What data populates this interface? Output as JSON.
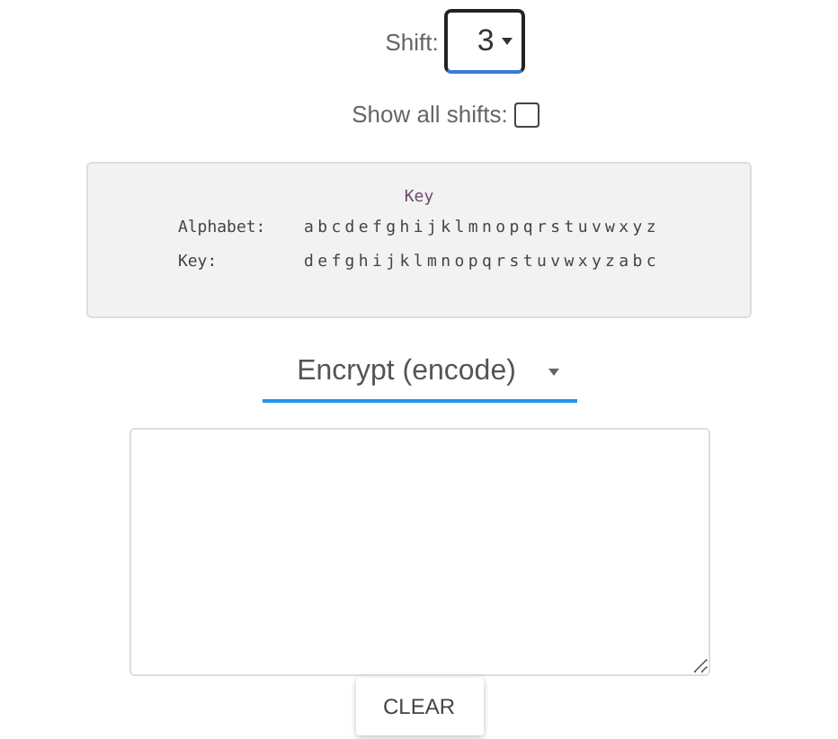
{
  "shift": {
    "label": "Shift:",
    "value": "3"
  },
  "show_all_shifts": {
    "label": "Show all shifts:",
    "checked": false
  },
  "key_table": {
    "title": "Key",
    "rows": [
      {
        "label": "Alphabet:",
        "letters": "abcdefghijklmnopqrstuvwxyz"
      },
      {
        "label": "Key:",
        "letters": "defghijklmnopqrstuvwxyzabc"
      }
    ]
  },
  "mode": {
    "value": "Encrypt (encode)"
  },
  "buttons": [
    {
      "label": "CLEAR"
    }
  ]
}
